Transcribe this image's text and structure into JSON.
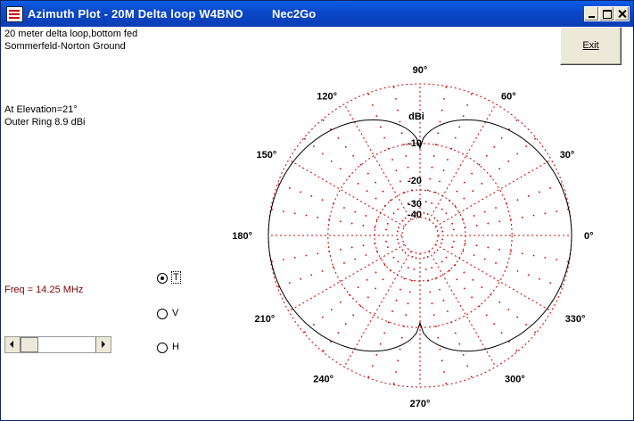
{
  "window": {
    "title": "Azimuth Plot - 20M Delta loop W4BNO",
    "app_name": "Nec2Go",
    "titlebar_color": "#0b47c7"
  },
  "info": {
    "line1": "20 meter delta loop,bottom fed",
    "line2": "Sommerfeld-Norton Ground",
    "elevation": "At Elevation=21°",
    "outer_ring": "Outer Ring 8.9 dBi",
    "freq": "Freq = 14.25 MHz"
  },
  "buttons": {
    "exit_label": "Exit"
  },
  "radios": [
    {
      "label": "T",
      "checked": true
    },
    {
      "label": "V",
      "checked": false
    },
    {
      "label": "H",
      "checked": false
    }
  ],
  "scrollbar": {
    "value_fraction": 0.1
  },
  "plot": {
    "unit_label": "dBi",
    "ring_labels": [
      "10",
      "20",
      "30",
      "40"
    ],
    "angle_labels": [
      "0°",
      "30°",
      "60°",
      "90°",
      "120°",
      "150°",
      "180°",
      "210°",
      "240°",
      "270°",
      "300°",
      "330°"
    ],
    "grid_color": "#cc0000",
    "pattern_color": "#000000"
  }
}
